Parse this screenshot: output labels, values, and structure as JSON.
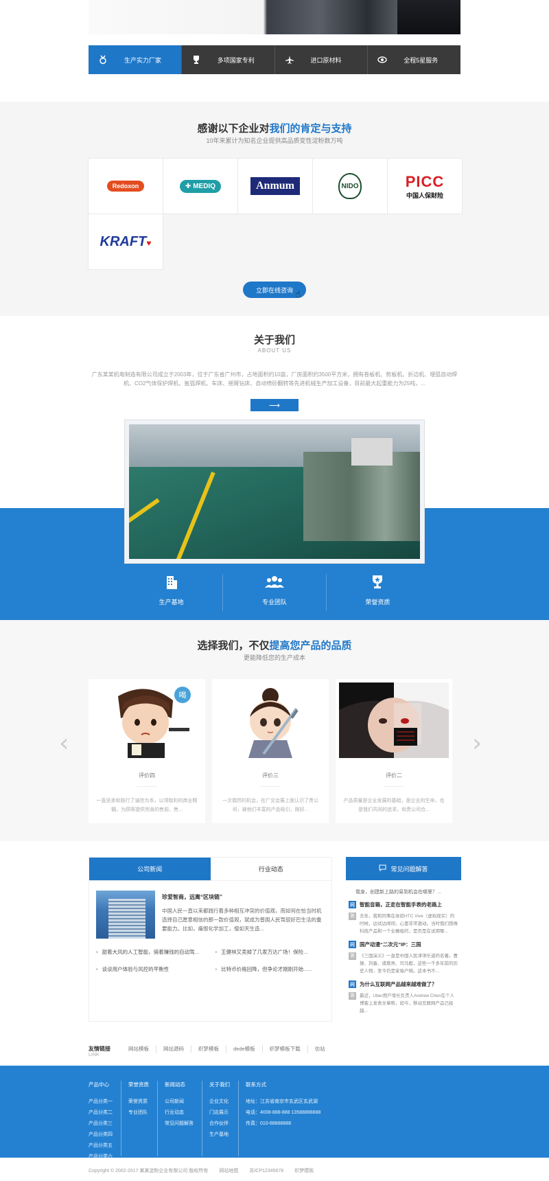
{
  "features": [
    {
      "label": "生产实力厂家",
      "icon": "medal-icon",
      "active": true
    },
    {
      "label": "多项国家专利",
      "icon": "trophy-icon",
      "active": false
    },
    {
      "label": "进口原材料",
      "icon": "airplane-icon",
      "active": false
    },
    {
      "label": "全程5星服务",
      "icon": "eye-icon",
      "active": false
    }
  ],
  "clients": {
    "title_plain": "感谢以下企业对",
    "title_highlight": "我们的肯定与支持",
    "subtitle": "10年来累计为知名企业提供高品质变性淀粉数万吨",
    "logos": [
      {
        "name": "Redoxon",
        "text": "Redoxon"
      },
      {
        "name": "MEDIQ",
        "text": "MEDIQ"
      },
      {
        "name": "Anmum",
        "text": "Anmum"
      },
      {
        "name": "NIDO",
        "text": "NIDO"
      },
      {
        "name": "PICC",
        "text": "PICC",
        "sub": "中国人保财险"
      },
      {
        "name": "KRAFT",
        "text": "KRAFT"
      }
    ],
    "consult_button": "立即在线咨询"
  },
  "about": {
    "title": "关于我们",
    "title_en": "ABOUT US",
    "description": "广东某某机电制造有限公司成立于2003年，位于广东省广州市，占地面积约10亩，厂房面积约3500平方米，拥有卷板机、剪板机、折边机、埋弧自动焊机、CO2气体保护焊机、氩弧焊机、车床、摇臂钻床、自动喷砂翻转等先进机械生产加工设备，目前最大起重能力为25吨，...",
    "more_button": "⟶"
  },
  "band": [
    {
      "label": "生产基地",
      "icon": "building-icon"
    },
    {
      "label": "专业团队",
      "icon": "team-icon"
    },
    {
      "label": "荣誉资质",
      "icon": "award-icon"
    }
  ],
  "choose": {
    "title_plain": "选择我们，不仅",
    "title_highlight": "提高您产品的品质",
    "subtitle": "更能降低您的生产成本",
    "cards": [
      {
        "name": "评价四",
        "text": "一直坚承和践行了诚信为本，以领取利的商业精髓，为顾客提供完善的售前、售..."
      },
      {
        "name": "评价三",
        "text": "一次偶然的机会，在广交会展上面认识了贵公司，被他们丰富的产品吸引，刚好..."
      },
      {
        "name": "评价二",
        "text": "产品质量是企业发展的基础，是企业的生命，也是我们共同的追求。和贵公司合..."
      }
    ],
    "prev": "‹",
    "next": "›"
  },
  "news": {
    "tabs": [
      {
        "label": "公司新闻",
        "active": true
      },
      {
        "label": "行业动态",
        "active": false
      }
    ],
    "featured_title": "珍爱智商，远离“区块链”",
    "featured_summary": "中国人民一直以来都践行着多种相互冲突的价值观，而如何在恰当时机选择自己愿意相信的那一款价值观，就成为普国人民驾驭好巴生活的重要能力。比如，痛恨化学加工，僧如天生造...",
    "items": [
      "甜着大风的人工智能，骑着赚钱的自动驾...",
      "王健林又卖掉了几家万达广场！保险...",
      "谈谈用户体验与风控的平衡性",
      "比特币价格回降，但争论才刚刚开始......"
    ]
  },
  "faq": {
    "title": "常见问题解答",
    "intro": "我身，创建新上路的易到机会在哪里？...",
    "items": [
      {
        "q": "智能音箱，正走在智能手表的老路上",
        "a": "去年，我和同事在体验HTC Vive（虚拟现实）的时候，边试边闻彻，心里非常激动。当时我们想做科技产品和一个全栅极的，是否是在试用哪..."
      },
      {
        "q": "国产动漫“二次元”IP：三国",
        "a": "《三国演义》一直是中国人民津津乐道的名著。曹操、刘备、诸葛亮、司马懿，这些一千多年前的历史人物，至今仍是家喻户晓。这本书不..."
      },
      {
        "q": "为什么互联网产品越来越难做了？",
        "a": "最近，Uber用户增长负责人Andrew Chen在个人博客上发表文章称，如今，移动互联网产品已经越..."
      }
    ]
  },
  "friend_links": {
    "title": "友情链接",
    "title_en": "LINK",
    "items": [
      "网站模板",
      "网站源码",
      "织梦模板",
      "dede模板",
      "织梦模板下载",
      "仿站"
    ]
  },
  "footer": {
    "columns": [
      {
        "title": "产品中心",
        "items": [
          "产品分类一",
          "产品分类二",
          "产品分类三",
          "产品分类四",
          "产品分类五",
          "产品分类六"
        ]
      },
      {
        "title": "荣誉资质",
        "items": [
          "荣誉资质",
          "专业团队"
        ]
      },
      {
        "title": "新闻动态",
        "items": [
          "公司新闻",
          "行业动态",
          "常见问题解答"
        ]
      },
      {
        "title": "关于我们",
        "items": [
          "企业文化",
          "门店展示",
          "合作伙伴",
          "生产基地"
        ]
      }
    ],
    "contact": {
      "title": "联系方式",
      "address": "地址：江苏省南京市玄武区玄武湖",
      "phone": "电话：4008-888-888  13588888888",
      "fax": "传真：010-88888888"
    }
  },
  "copyright": {
    "text": "Copyright © 2002-2017 某某淀粉企业有限公司 版权所有",
    "sitemap": "网站地图",
    "icp": "苏ICP12345678",
    "theme": "织梦模板"
  }
}
